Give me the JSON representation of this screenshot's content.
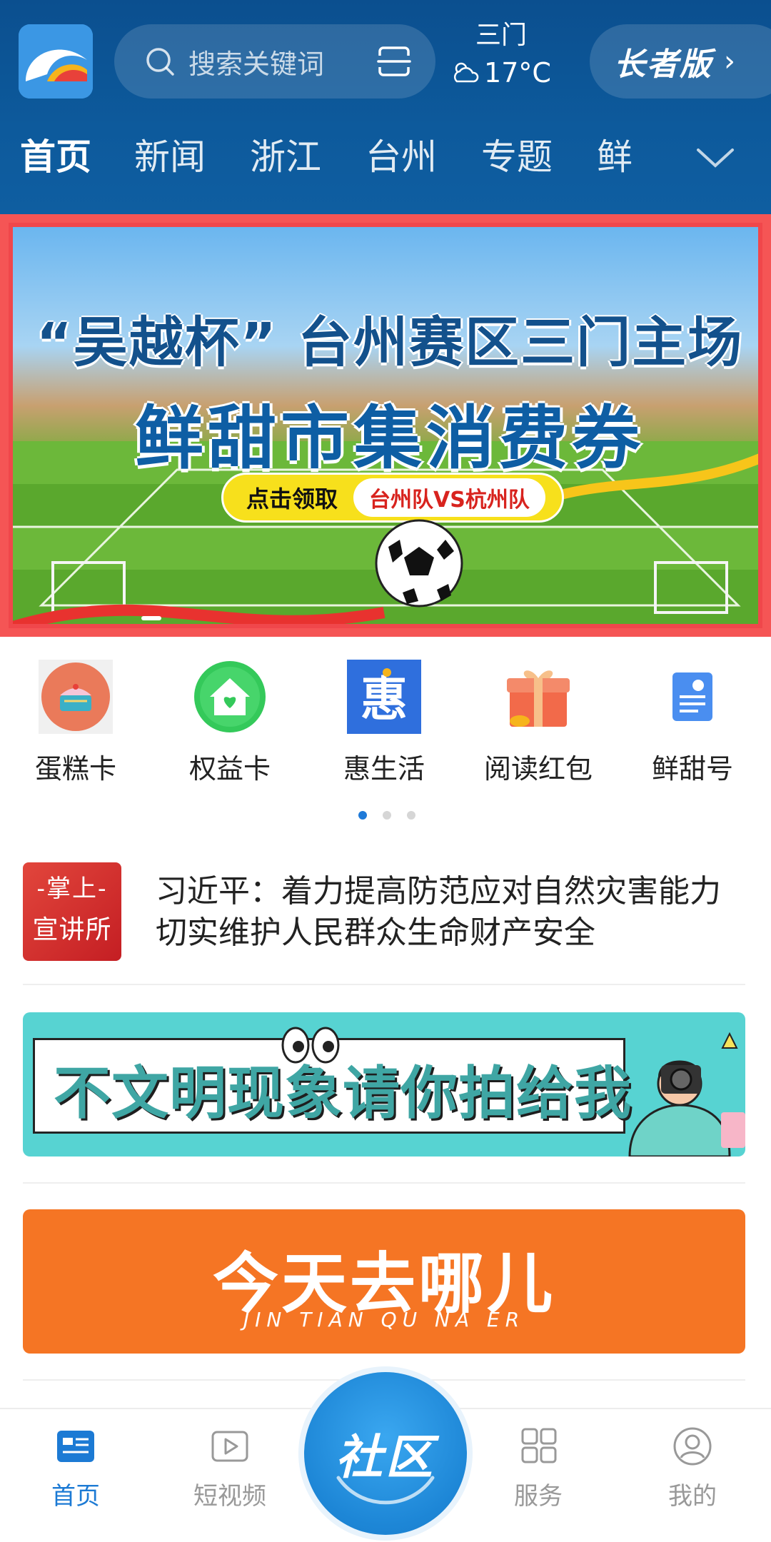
{
  "header": {
    "search_placeholder": "搜索关键词",
    "weather": {
      "city": "三门",
      "temperature": "17°C",
      "icon": "cloudy-icon"
    },
    "elder_mode_label": "长者版",
    "elder_mode_chevron": "›"
  },
  "tabs": [
    {
      "label": "首页",
      "active": true
    },
    {
      "label": "新闻"
    },
    {
      "label": "浙江"
    },
    {
      "label": "台州"
    },
    {
      "label": "专题"
    },
    {
      "label": "鲜"
    }
  ],
  "banner": {
    "title_line1": "“吴越杯” 台州赛区三门主场",
    "title_line2": "鲜甜市集消费券",
    "claim_label": "点击领取",
    "match_label": "台州队VS杭州队"
  },
  "quick_links": [
    {
      "label": "蛋糕卡",
      "icon": "cake-icon"
    },
    {
      "label": "权益卡",
      "icon": "home-heart-icon"
    },
    {
      "label": "惠生活",
      "icon": "hui-icon",
      "icon_text": "惠"
    },
    {
      "label": "阅读红包",
      "icon": "gift-box-icon"
    },
    {
      "label": "鲜甜号",
      "icon": "document-badge-icon"
    }
  ],
  "news": {
    "badge_line1": "-掌上-",
    "badge_line2": "宣讲所",
    "headline": "习近平：着力提高防范应对自然灾害能力 切实维护人民群众生命财产安全"
  },
  "promo1": {
    "slogan": "不文明现象请你拍给我"
  },
  "promo2": {
    "title": "今天去哪儿",
    "pinyin": "JIN TIAN QU NA ER"
  },
  "bottom_nav": [
    {
      "label": "首页",
      "icon": "home-news-icon",
      "active": true
    },
    {
      "label": "短视频",
      "icon": "video-play-icon"
    },
    {
      "label": "社区",
      "icon": "community-icon",
      "center": true
    },
    {
      "label": "服务",
      "icon": "grid-icon"
    },
    {
      "label": "我的",
      "icon": "profile-icon"
    }
  ],
  "colors": {
    "header_bg": "#0d5a9c",
    "accent": "#1c7ad4",
    "banner_border": "#f0474b",
    "promo_teal": "#57d3d2",
    "promo_orange": "#f57524"
  }
}
